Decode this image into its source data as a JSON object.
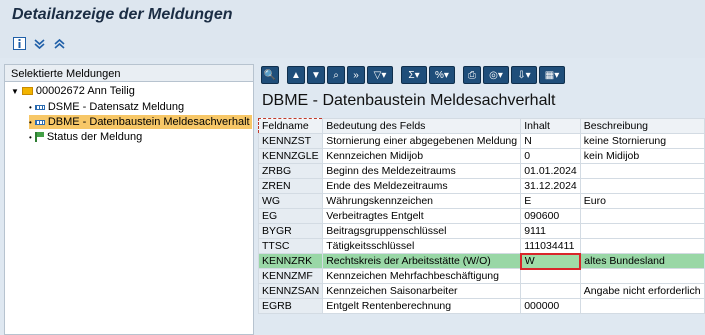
{
  "title": "Detailanzeige der Meldungen",
  "tree": {
    "header": "Selektierte Meldungen",
    "root_label": "00002672 Ann Teilig",
    "items": [
      {
        "label": "DSME - Datensatz Meldung"
      },
      {
        "label": "DBME - Datenbaustein Meldesachverhalt"
      },
      {
        "label": "Status der Meldung"
      }
    ]
  },
  "section_title": "DBME - Datenbaustein Meldesachverhalt",
  "table": {
    "headers": [
      "Feldname",
      "Bedeutung des Felds",
      "Inhalt",
      "Beschreibung"
    ],
    "rows": [
      [
        "KENNZST",
        "Stornierung einer abgegebenen Meldung",
        "N",
        "keine Stornierung"
      ],
      [
        "KENNZGLE",
        "Kennzeichen Midijob",
        "0",
        "kein Midijob"
      ],
      [
        "ZRBG",
        "Beginn des Meldezeitraums",
        "01.01.2024",
        ""
      ],
      [
        "ZREN",
        "Ende des Meldezeitraums",
        "31.12.2024",
        ""
      ],
      [
        "WG",
        "Währungskennzeichen",
        "E",
        "Euro"
      ],
      [
        "EG",
        "Verbeitragtes Entgelt",
        "090600",
        ""
      ],
      [
        "BYGR",
        "Beitragsgruppenschlüssel",
        "9111",
        ""
      ],
      [
        "TTSC",
        "Tätigkeitsschlüssel",
        "111034411",
        ""
      ],
      [
        "KENNZRK",
        "Rechtskreis der Arbeitsstätte (W/O)",
        "W",
        "altes Bundesland"
      ],
      [
        "KENNZMF",
        "Kennzeichen Mehrfachbeschäftigung",
        "",
        ""
      ],
      [
        "KENNZSAN",
        "Kennzeichen Saisonarbeiter",
        "",
        "Angabe nicht erforderlich"
      ],
      [
        "EGRB",
        "Entgelt Rentenberechnung",
        "000000",
        ""
      ]
    ]
  },
  "highlight_color": "#99d7a6",
  "selection_color": "#f7c767"
}
